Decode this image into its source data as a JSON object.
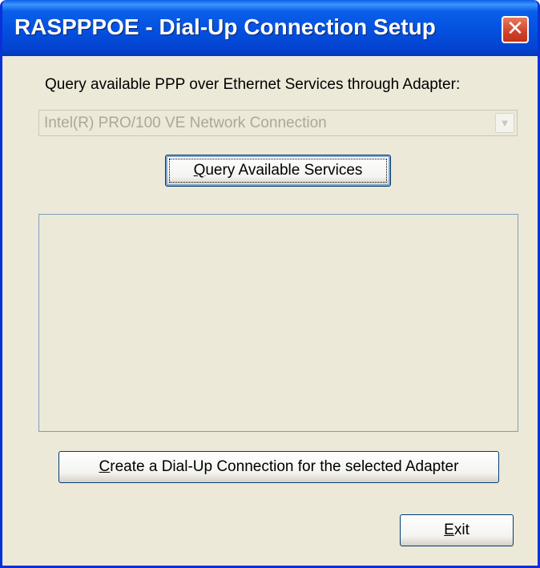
{
  "window": {
    "title": "RASPPPOE - Dial-Up Connection Setup",
    "close_glyph": "✕"
  },
  "adapter": {
    "label": "Query available PPP over Ethernet Services through Adapter:",
    "selected": "Intel(R) PRO/100 VE Network Connection",
    "arrow_glyph": "▼"
  },
  "buttons": {
    "query_hotkey": "Q",
    "query_rest": "uery Available Services",
    "create_hotkey": "C",
    "create_rest": "reate a Dial-Up Connection for the selected Adapter",
    "exit_hotkey": "E",
    "exit_rest": "xit"
  },
  "services": {
    "items": []
  },
  "colors": {
    "titlebar": "#0450df",
    "dialog_face": "#ece9d8",
    "close_button": "#d0412a",
    "disabled_text": "#aca899"
  }
}
